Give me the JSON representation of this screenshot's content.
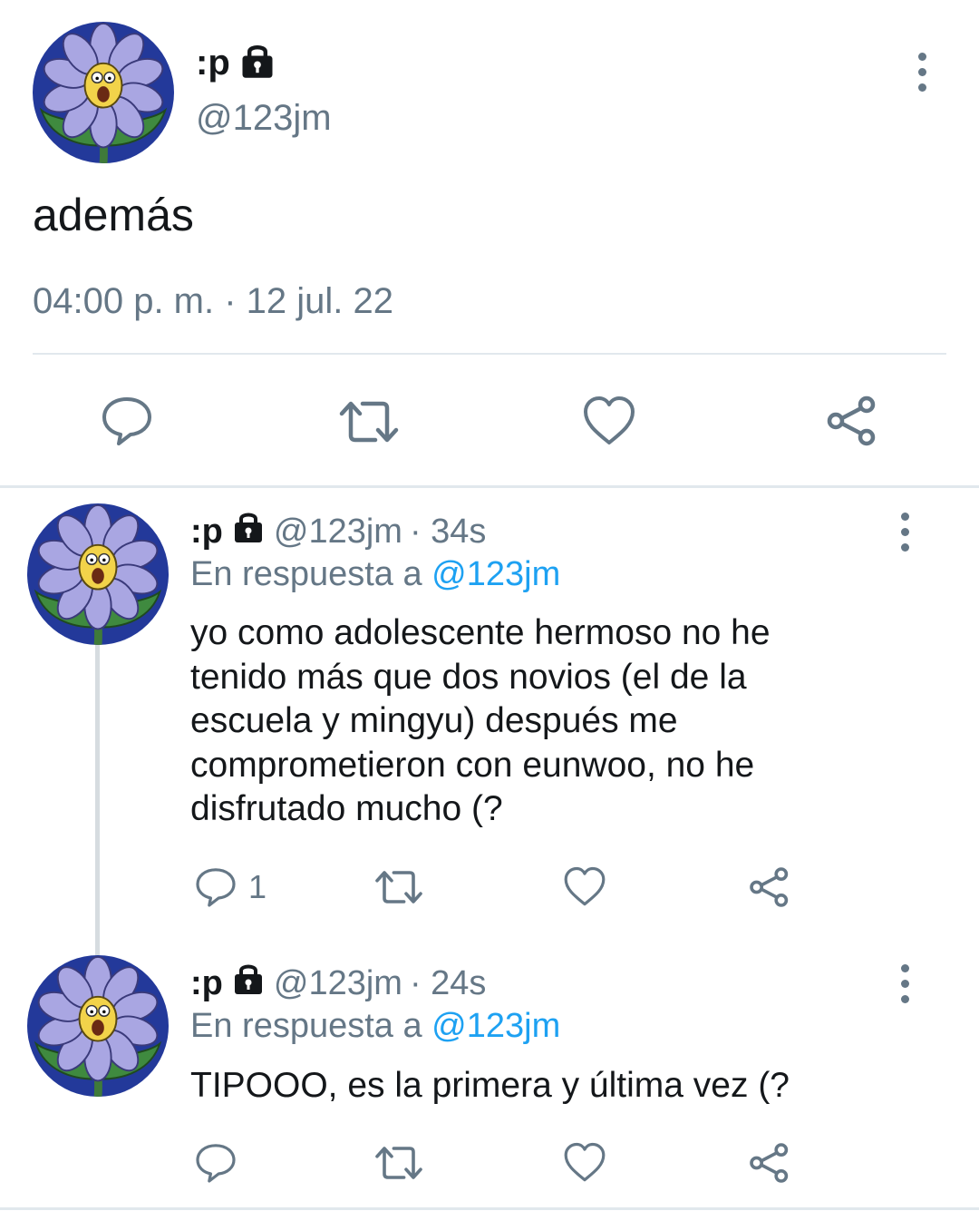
{
  "main_tweet": {
    "display_name": ":p",
    "handle": "@123jm",
    "text": "además",
    "timestamp": "04:00 p. m. · 12 jul. 22"
  },
  "replies": [
    {
      "display_name": ":p",
      "handle": "@123jm",
      "age": "· 34s",
      "reply_prefix": "En respuesta a",
      "reply_to": "@123jm",
      "lines": [
        "yo como adolescente hermoso no he",
        "tenido más que dos novios (el de la",
        "escuela y mingyu) después me",
        "comprometieron con eunwoo, no he",
        "disfrutado mucho (?"
      ],
      "reply_count": "1"
    },
    {
      "display_name": ":p",
      "handle": "@123jm",
      "age": "· 24s",
      "reply_prefix": "En respuesta a",
      "reply_to": "@123jm",
      "lines": [
        "TIPOOO, es la primera y última vez (?"
      ],
      "reply_count": ""
    }
  ],
  "icons": {
    "reply": "reply-icon",
    "retweet": "retweet-icon",
    "like": "heart-icon",
    "share": "share-icon",
    "lock": "lock-icon",
    "more": "more-vertical-icon"
  },
  "colors": {
    "text": "#14171a",
    "muted": "#657786",
    "link": "#1da1f2",
    "divider": "#e1e8ed"
  }
}
